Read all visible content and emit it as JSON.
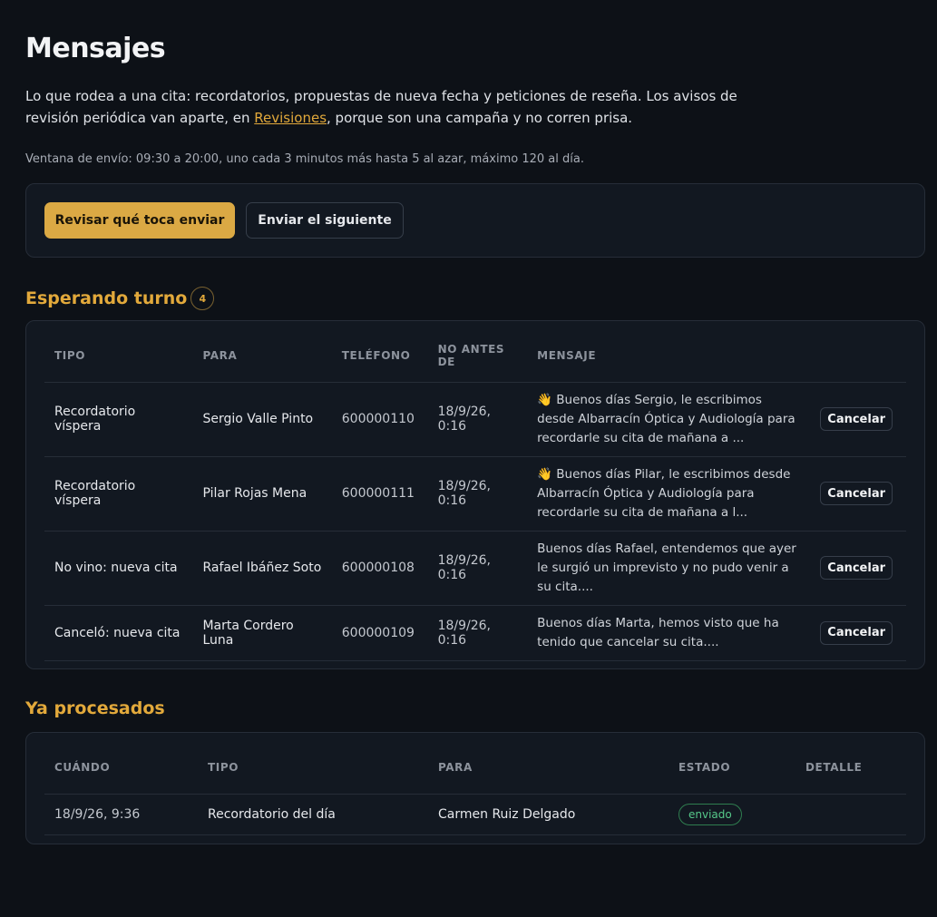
{
  "header": {
    "title": "Mensajes",
    "intro_before_link": "Lo que rodea a una cita: recordatorios, propuestas de nueva fecha y peticiones de reseña. Los avisos de revisión periódica van aparte, en ",
    "intro_link": "Revisiones",
    "intro_after_link": ", porque son una campaña y no corren prisa.",
    "window_note": "Ventana de envío: 09:30 a 20:00, uno cada 3 minutos más hasta 5 al azar, máximo 120 al día."
  },
  "actions": {
    "review_label": "Revisar qué toca enviar",
    "send_next_label": "Enviar el siguiente"
  },
  "queue": {
    "title": "Esperando turno",
    "count": "4",
    "columns": [
      "TIPO",
      "PARA",
      "TELÉFONO",
      "NO ANTES DE",
      "MENSAJE"
    ],
    "cancel_label": "Cancelar",
    "rows": [
      {
        "type": "Recordatorio víspera",
        "to": "Sergio Valle Pinto",
        "phone": "600000110",
        "not_before": "18/9/26, 0:16",
        "message": "👋 Buenos días Sergio, le escribimos desde Albarracín Óptica y Audiología para recordarle su cita de mañana a ..."
      },
      {
        "type": "Recordatorio víspera",
        "to": "Pilar Rojas Mena",
        "phone": "600000111",
        "not_before": "18/9/26, 0:16",
        "message": "👋 Buenos días Pilar, le escribimos desde Albarracín Óptica y Audiología para recordarle su cita de mañana a l..."
      },
      {
        "type": "No vino: nueva cita",
        "to": "Rafael Ibáñez Soto",
        "phone": "600000108",
        "not_before": "18/9/26, 0:16",
        "message": "Buenos días Rafael, entendemos que ayer le surgió un imprevisto y no pudo venir a su cita...."
      },
      {
        "type": "Canceló: nueva cita",
        "to": "Marta Cordero Luna",
        "phone": "600000109",
        "not_before": "18/9/26, 0:16",
        "message": "Buenos días Marta, hemos visto que ha tenido que cancelar su cita...."
      }
    ]
  },
  "processed": {
    "title": "Ya procesados",
    "columns": [
      "CUÁNDO",
      "TIPO",
      "PARA",
      "ESTADO",
      "DETALLE"
    ],
    "rows": [
      {
        "when": "18/9/26, 9:36",
        "type": "Recordatorio del día",
        "to": "Carmen Ruiz Delgado",
        "status": "enviado",
        "detail": ""
      }
    ]
  }
}
